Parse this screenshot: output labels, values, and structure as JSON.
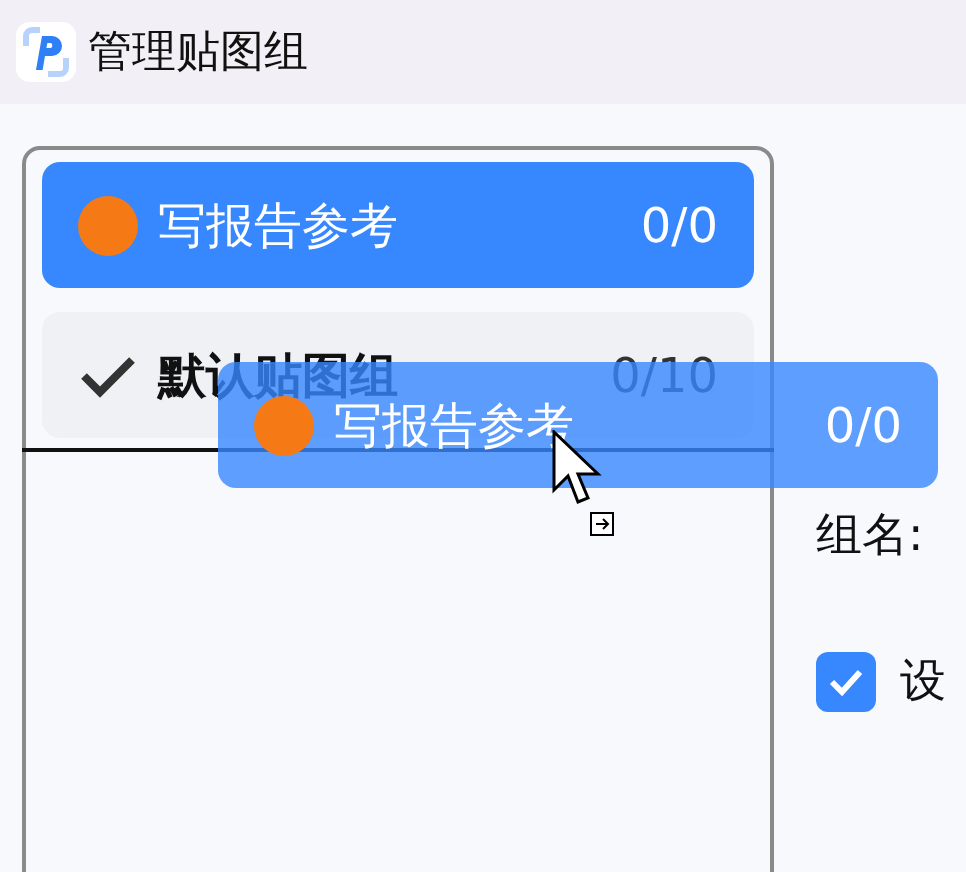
{
  "window": {
    "title": "管理贴图组"
  },
  "groups": [
    {
      "kind": "dot",
      "name": "写报告参考",
      "count": "0/0",
      "color": "#f57a16",
      "selected": true
    },
    {
      "kind": "check",
      "name": "默认贴图组",
      "count": "0/10",
      "selected": false
    }
  ],
  "drag_ghost": {
    "name": "写报告参考",
    "count": "0/0",
    "color": "#f57a16"
  },
  "form": {
    "name_label": "组名:",
    "checkbox": {
      "label": "设",
      "checked": true
    }
  }
}
